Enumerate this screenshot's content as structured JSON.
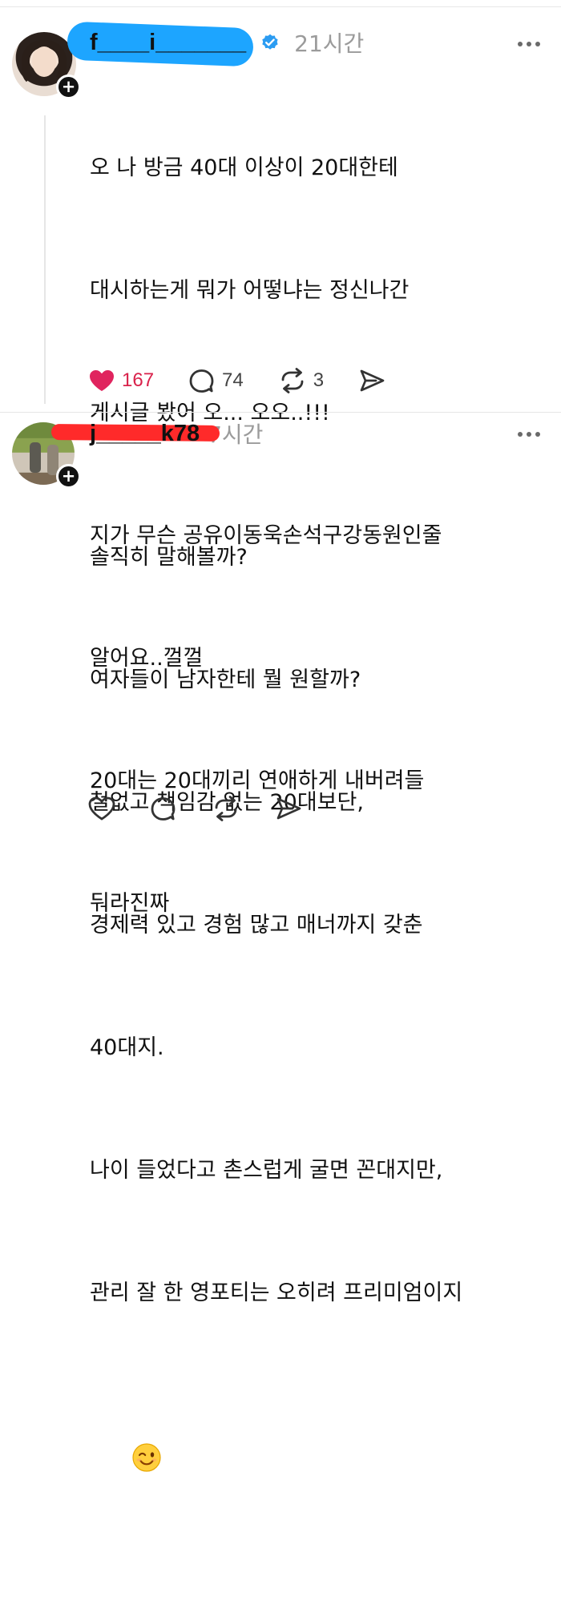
{
  "posts": [
    {
      "username": "f____i_______",
      "time": "21시간",
      "lines": [
        "오 나 방금 40대 이상이 20대한테",
        "대시하는게 뭐가 어떻냐는 정신나간",
        "게시글 봤어 오... 오오..!!!",
        "지가 무슨 공유이동욱손석구강동원인줄",
        "알어요..껄껄",
        "20대는 20대끼리 연애하게 내버려들",
        "둬라진짜"
      ],
      "likes": "167",
      "comments": "74",
      "reposts": "3",
      "verified": true
    },
    {
      "username": "j_____k78",
      "time": "7시간",
      "lines": [
        "솔직히 말해볼까?",
        "여자들이 남자한테 뭘 원할까?",
        "철없고 책임감 없는 20대보단,",
        "경제력 있고 경험 많고 매너까지 갖춘",
        "40대지.",
        "나이 들었다고 촌스럽게 굴면 꼰대지만,",
        "관리 잘 한 영포티는 오히려 프리미엄이지"
      ],
      "emoji": "wink-emoji"
    }
  ],
  "colors": {
    "like_active": "#e0245e",
    "timestamp": "#9b9b9b",
    "redaction_blue": "#1da5ff",
    "redaction_red": "#ff2a2a"
  }
}
